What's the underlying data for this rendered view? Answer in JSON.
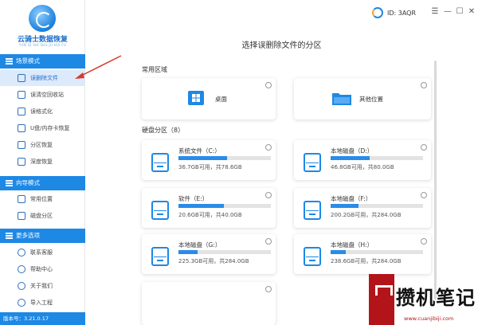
{
  "app": {
    "title": "云骑士数据恢复",
    "subtitle": "YUN QI SHI SHU JU HUI FU",
    "version_label": "版本号：3.21.0.17",
    "id_label": "ID: 3AQR"
  },
  "window_controls": {
    "menu": "☰",
    "minimize": "—",
    "maximize": "☐",
    "close": "✕"
  },
  "sidebar": {
    "sections": [
      {
        "label": "场景模式",
        "items": [
          "误删除文件",
          "误清空回收站",
          "误格式化",
          "U盘/内存卡恢复",
          "分区恢复",
          "深度恢复"
        ],
        "active_index": 0
      },
      {
        "label": "向导模式",
        "items": [
          "常用位置",
          "磁盘分区"
        ]
      },
      {
        "label": "更多选项",
        "items": [
          "联系客服",
          "帮助中心",
          "关于我们",
          "导入工程"
        ]
      }
    ]
  },
  "main": {
    "title": "选择误删除文件的分区",
    "common_label": "常用区域",
    "common_items": [
      {
        "label": "桌面",
        "icon": "windows-icon"
      },
      {
        "label": "其他位置",
        "icon": "folder-icon"
      }
    ],
    "disk_label": "硬盘分区（8）",
    "disks": [
      {
        "name": "系统文件（C:）",
        "info": "36.7GB可用，共78.6GB",
        "used": 0.53
      },
      {
        "name": "本地磁盘（D:）",
        "info": "46.8GB可用，共80.0GB",
        "used": 0.42
      },
      {
        "name": "软件（E:）",
        "info": "20.6GB可用，共40.0GB",
        "used": 0.49
      },
      {
        "name": "本地磁盘（F:）",
        "info": "200.2GB可用，共284.0GB",
        "used": 0.3
      },
      {
        "name": "本地磁盘（G:）",
        "info": "225.3GB可用，共284.0GB",
        "used": 0.21
      },
      {
        "name": "本地磁盘（H:）",
        "info": "238.6GB可用，共284.0GB",
        "used": 0.16
      }
    ]
  },
  "watermark": {
    "text": "攒机笔记",
    "url": "www.cuanjibiji.com"
  },
  "colors": {
    "accent": "#1e88e5",
    "bar_fill": "#2a8be8",
    "watermark_red": "#b3141a"
  }
}
